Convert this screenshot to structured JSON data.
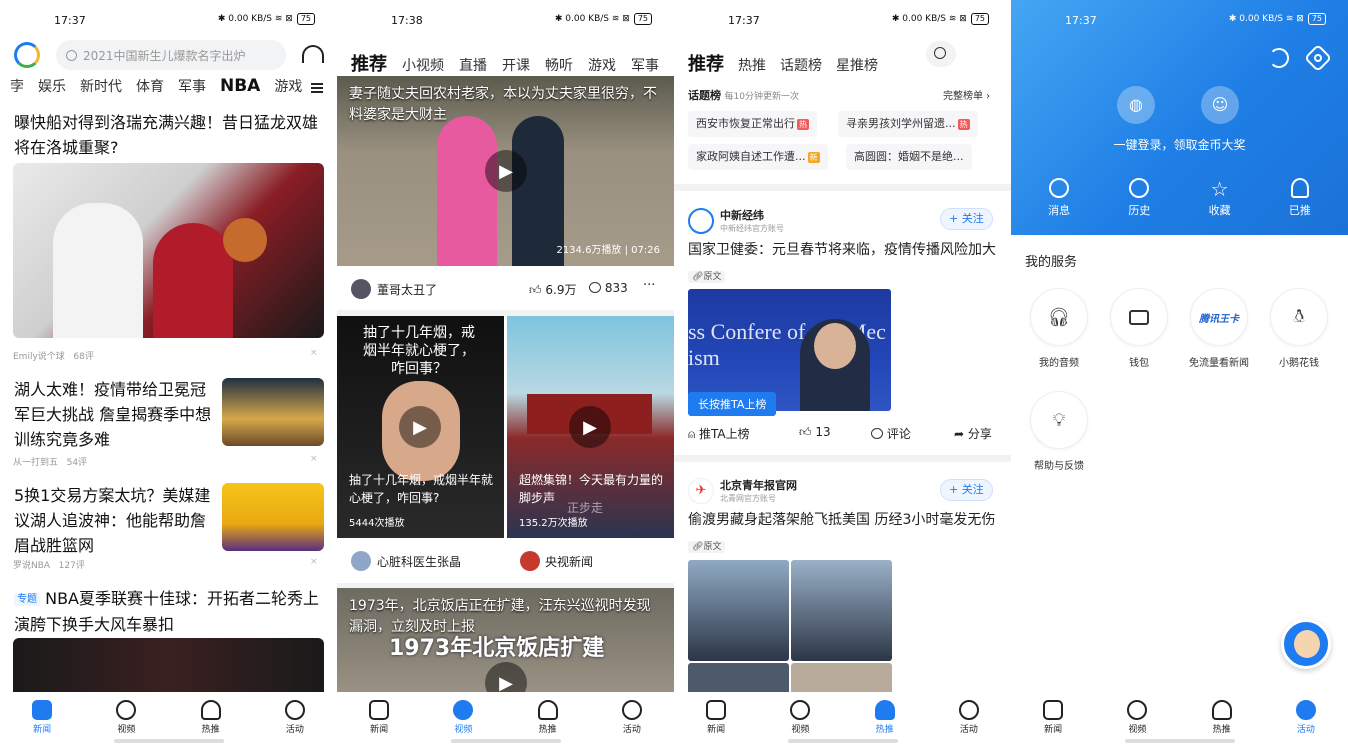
{
  "p1": {
    "time": "17:37",
    "status_icons": "✱ 0.00 KB/S ≋ ⊠",
    "battery": "75",
    "search_placeholder": "2021中国新生儿爆款名字出炉",
    "channels": [
      "孛",
      "娱乐",
      "新时代",
      "体育",
      "军事",
      "NBA",
      "游戏"
    ],
    "articles": [
      {
        "title": "曝快船对得到洛瑞充满兴趣！昔日猛龙双雄将在洛城重聚?",
        "source": "Emily说个球",
        "comments": "68评"
      },
      {
        "title": "湖人太难！疫情带给卫冕冠军巨大挑战 詹皇揭赛季中想训练究竟多难",
        "source": "从一打到五",
        "comments": "54评"
      },
      {
        "title": "5换1交易方案太坑？美媒建议湖人追波神：他能帮助詹眉战胜篮网",
        "source": "罗说NBA",
        "comments": "127评"
      },
      {
        "tag": "专题",
        "title": "NBA夏季联赛十佳球：开拓者二轮秀上演胯下换手大风车暴扣"
      }
    ],
    "close": "×",
    "nav": [
      "新闻",
      "视频",
      "热推",
      "活动"
    ]
  },
  "p2": {
    "time": "17:38",
    "battery": "75",
    "tabs": [
      "推荐",
      "小视频",
      "直播",
      "开课",
      "畅听",
      "游戏",
      "军事"
    ],
    "video1": {
      "title": "妻子随丈夫回农村老家，本以为丈夫家里很穷，不料婆家是大财主",
      "plays": "2134.6万播放",
      "duration": "07:26",
      "author": "董哥太丑了",
      "likes": "6.9万",
      "comments": "833",
      "more": "···"
    },
    "short1": {
      "overlay": "抽了十几年烟，戒烟半年就心梗了，咋回事？",
      "title": "抽了十几年烟，戒烟半年就心梗了，咋回事?",
      "plays": "5444次播放",
      "author": "心脏科医生张晶"
    },
    "short2": {
      "title": "超燃集锦！今天最有力量的脚步声",
      "plays": "135.2万次播放",
      "author": "央视新闻",
      "watermark": "正步走"
    },
    "video2": {
      "title": "1973年，北京饭店正在扩建，汪东兴巡视时发现漏洞，立刻及时上报",
      "overlay": "1973年北京饭店扩建"
    },
    "nav": [
      "新闻",
      "视频",
      "热推",
      "活动"
    ]
  },
  "p3": {
    "time": "17:37",
    "battery": "75",
    "tabs": [
      "推荐",
      "热推",
      "话题榜",
      "星推榜"
    ],
    "topic_title": "话题榜",
    "topic_sub": "每10分钟更新一次",
    "topic_more": "完整榜单 ›",
    "topics": [
      {
        "text": "西安市恢复正常出行",
        "badge": "热"
      },
      {
        "text": "寻亲男孩刘学州留遗...",
        "badge": "热"
      },
      {
        "text": "家政阿姨自述工作遭...",
        "badge": "新"
      },
      {
        "text": "高圆圆：婚姻不是绝..."
      }
    ],
    "post1": {
      "name": "中新经纬",
      "sub": "中新经纬官方账号",
      "follow": "+ 关注",
      "title": "国家卫健委：元旦春节将来临，疫情传播风险加大",
      "original": "原文",
      "tooltip": "长按推TA上榜",
      "push": "推TA上榜",
      "likes": "13",
      "comment": "评论",
      "share": "分享",
      "image_text": "ss Confere  of  trol Mec  ism"
    },
    "post2": {
      "name": "北京青年报官网",
      "sub": "北青网官方账号",
      "follow": "+ 关注",
      "title": "偷渡男藏身起落架舱飞抵美国 历经3小时毫发无伤",
      "original": "原文"
    },
    "nav": [
      "新闻",
      "视频",
      "热推",
      "活动"
    ]
  },
  "p4": {
    "time": "17:37",
    "battery": "75",
    "login_text": "一键登录，领取金币大奖",
    "quick": [
      "消息",
      "历史",
      "收藏",
      "已推"
    ],
    "services_title": "我的服务",
    "services": [
      "我的音频",
      "钱包",
      "免流量看新闻",
      "小鹅花钱",
      "帮助与反馈"
    ],
    "kingcard": "腾讯王卡",
    "nav": [
      "新闻",
      "视频",
      "热推",
      "活动"
    ]
  },
  "colors": {
    "accent": "#1e7bf0",
    "hot": "#f25a5a",
    "header_blue": "#2f8ff0"
  }
}
